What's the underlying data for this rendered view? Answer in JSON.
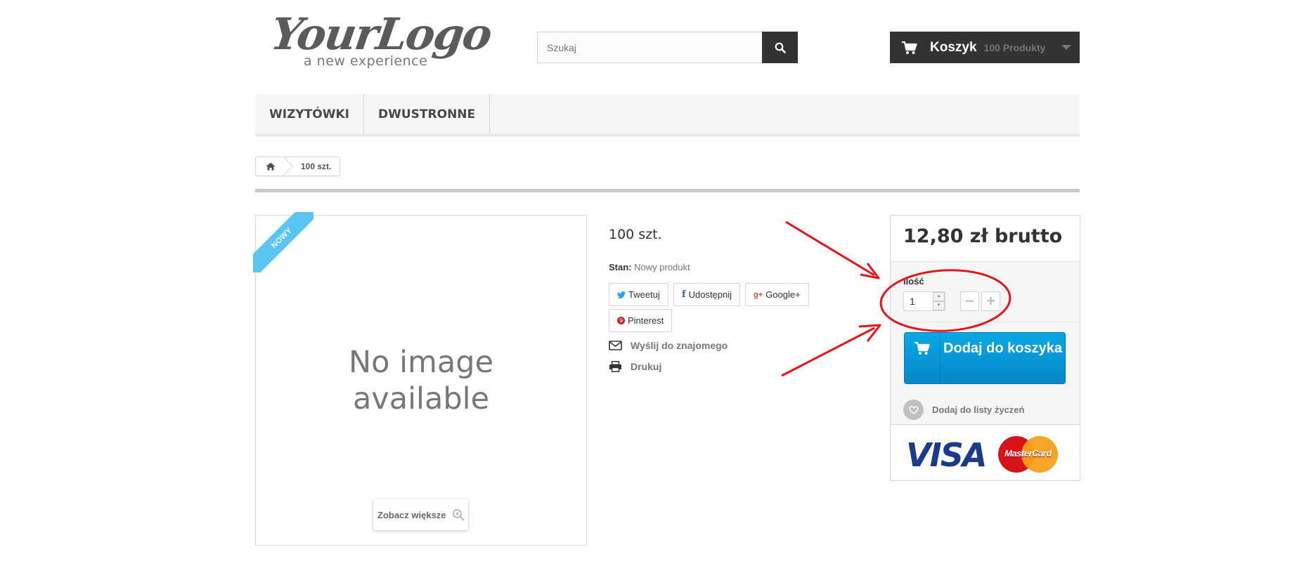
{
  "header": {
    "logo": {
      "script": "YourLogo",
      "tagline": "a new experience"
    },
    "search": {
      "placeholder": "Szukaj",
      "value": "",
      "button_icon": "search-icon"
    },
    "cart": {
      "label": "Koszyk",
      "count": "100 Produkty",
      "icon": "cart-icon"
    }
  },
  "menu": {
    "items": [
      "WIZYTÓWKI",
      "DWUSTRONNE"
    ]
  },
  "breadcrumb": {
    "home_icon": "home-icon",
    "current": "100 szt."
  },
  "image_panel": {
    "ribbon": "NOWY",
    "no_image_line1": "No image",
    "no_image_line2": "available",
    "zoom_label": "Zobacz większe"
  },
  "product": {
    "title": "100 szt.",
    "condition_label": "Stan:",
    "condition_value": "Nowy produkt",
    "share": {
      "tweet": "Tweetuj",
      "facebook": "Udostępnij",
      "google": "Google+",
      "pinterest": "Pinterest"
    },
    "send_to_friend": "Wyślij do znajomego",
    "print": "Drukuj"
  },
  "buy_block": {
    "price": "12,80 zł brutto",
    "quantity_label": "Ilość",
    "quantity_value": "1",
    "minus": "−",
    "plus": "+",
    "add_to_cart": "Dodaj do koszyka",
    "wishlist": "Dodaj do listy życzeń",
    "cards": {
      "visa": "VISA",
      "mastercard": "MasterCard"
    }
  },
  "colors": {
    "dark": "#333333",
    "button_blue": "#0687ca",
    "ribbon": "#5ac5f0",
    "annotation_red": "#e8141b"
  }
}
